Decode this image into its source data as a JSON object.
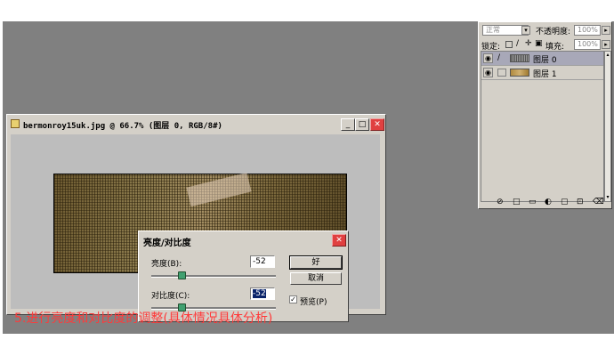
{
  "layers_panel": {
    "blend_mode": "正常",
    "opacity_label": "不透明度:",
    "opacity_value": "100%",
    "lock_label": "锁定:",
    "fill_label": "填充:",
    "fill_value": "100%",
    "layers": [
      {
        "name": "图层 0",
        "visible": true,
        "selected": true
      },
      {
        "name": "图层 1",
        "visible": true,
        "selected": false
      }
    ],
    "footer_icons": [
      "link-icon",
      "fx-icon",
      "mask-icon",
      "folder-icon",
      "adjustment-icon",
      "new-layer-icon",
      "trash-icon"
    ]
  },
  "document": {
    "title": "bermonroy15uk.jpg @ 66.7% (图层 0, RGB/8#)"
  },
  "dialog": {
    "title": "亮度/对比度",
    "brightness_label": "亮度(B):",
    "brightness_value": "-52",
    "contrast_label": "对比度(C):",
    "contrast_value": "-52",
    "ok_label": "好",
    "cancel_label": "取消",
    "preview_label": "预览(P)",
    "preview_checked": true
  },
  "caption": "5.进行亮度和对比度的调整(具体情况具体分析)"
}
